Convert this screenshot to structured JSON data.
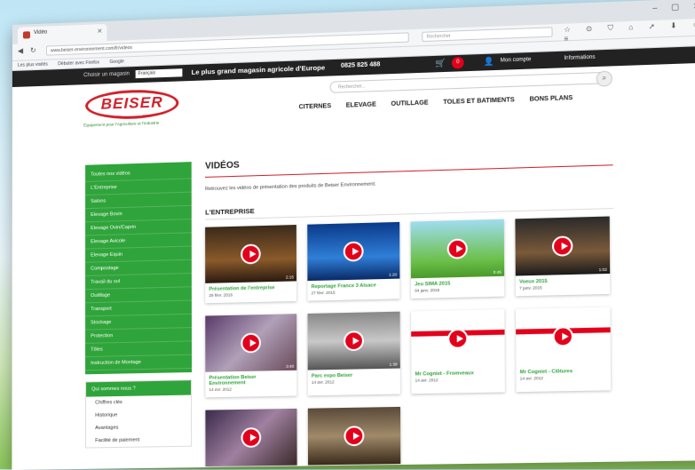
{
  "browser": {
    "tab_title": "Vidéo",
    "url": "www.beiser-environnement.com/fr/videos",
    "search_placeholder": "Rechercher",
    "window_controls": "– ▢ ✕",
    "toolbar_icons": "☆ ⊙ ⛉ ⌂ ➚ ⬇ ☺ ≡",
    "bookmarks": [
      "Les plus visités",
      "Débuter avec Firefox",
      "Google"
    ]
  },
  "topbar": {
    "language_label": "Choisir un magasin",
    "language_value": "Français",
    "slogan": "Le plus grand magasin agricole d'Europe",
    "phone": "0825 825 488",
    "cart_count": "0",
    "account": "Mon compte",
    "info": "Informations"
  },
  "header": {
    "logo_text": "BEISER",
    "tagline": "Équipement pour l'Agriculture et l'Industrie",
    "search_placeholder": "Rechercher...",
    "nav": [
      "CITERNES",
      "ELEVAGE",
      "OUTILLAGE",
      "TOLES ET BATIMENTS",
      "BONS PLANS"
    ]
  },
  "sidebar": {
    "categories": [
      "Toutes nos vidéos",
      "L'Entreprise",
      "Salons",
      "Elevage Bovin",
      "Elevage Ovin/Caprin",
      "Elevage Avicole",
      "Elevage Equin",
      "Compostage",
      "Travail du sol",
      "Outillage",
      "Transport",
      "Stockage",
      "Protection",
      "Tôles",
      "Instruction de Montage"
    ],
    "about_title": "Qui sommes nous ?",
    "about_items": [
      "Chiffres clés",
      "Historique",
      "Avantages",
      "Facilité de paiement"
    ]
  },
  "content": {
    "title": "VIDÉOS",
    "intro": "Retrouvez les vidéos de présentation des produits de Beiser Environnement.",
    "section": "L'ENTREPRISE",
    "videos": [
      {
        "title": "Présentation de l'entreprise",
        "date": "29 févr. 2016",
        "duration": "2:15"
      },
      {
        "title": "Reportage France 3 Alsace",
        "date": "27 févr. 2015",
        "duration": "1:20"
      },
      {
        "title": "Jeu SIMA 2015",
        "date": "04 janv. 2015",
        "duration": "0:45"
      },
      {
        "title": "Voeux 2015",
        "date": "7 janv. 2015",
        "duration": "1:02"
      },
      {
        "title": "Présentation Beiser Environnement",
        "date": "14 avr. 2012",
        "duration": "3:40"
      },
      {
        "title": "Parc expo Beiser",
        "date": "14 avr. 2012",
        "duration": "1:38"
      },
      {
        "title": "Mr Cogniet - Fromveaux",
        "date": "14 avr. 2012",
        "duration": "1:12"
      },
      {
        "title": "Mr Cogniet - Clôtures",
        "date": "14 avr. 2012",
        "duration": "1:05"
      },
      {
        "title": "",
        "date": "",
        "duration": ""
      },
      {
        "title": "",
        "date": "",
        "duration": ""
      }
    ]
  },
  "colors": {
    "brand_red": "#d0202a",
    "brand_green": "#2fa43a",
    "topbar": "#222222"
  }
}
